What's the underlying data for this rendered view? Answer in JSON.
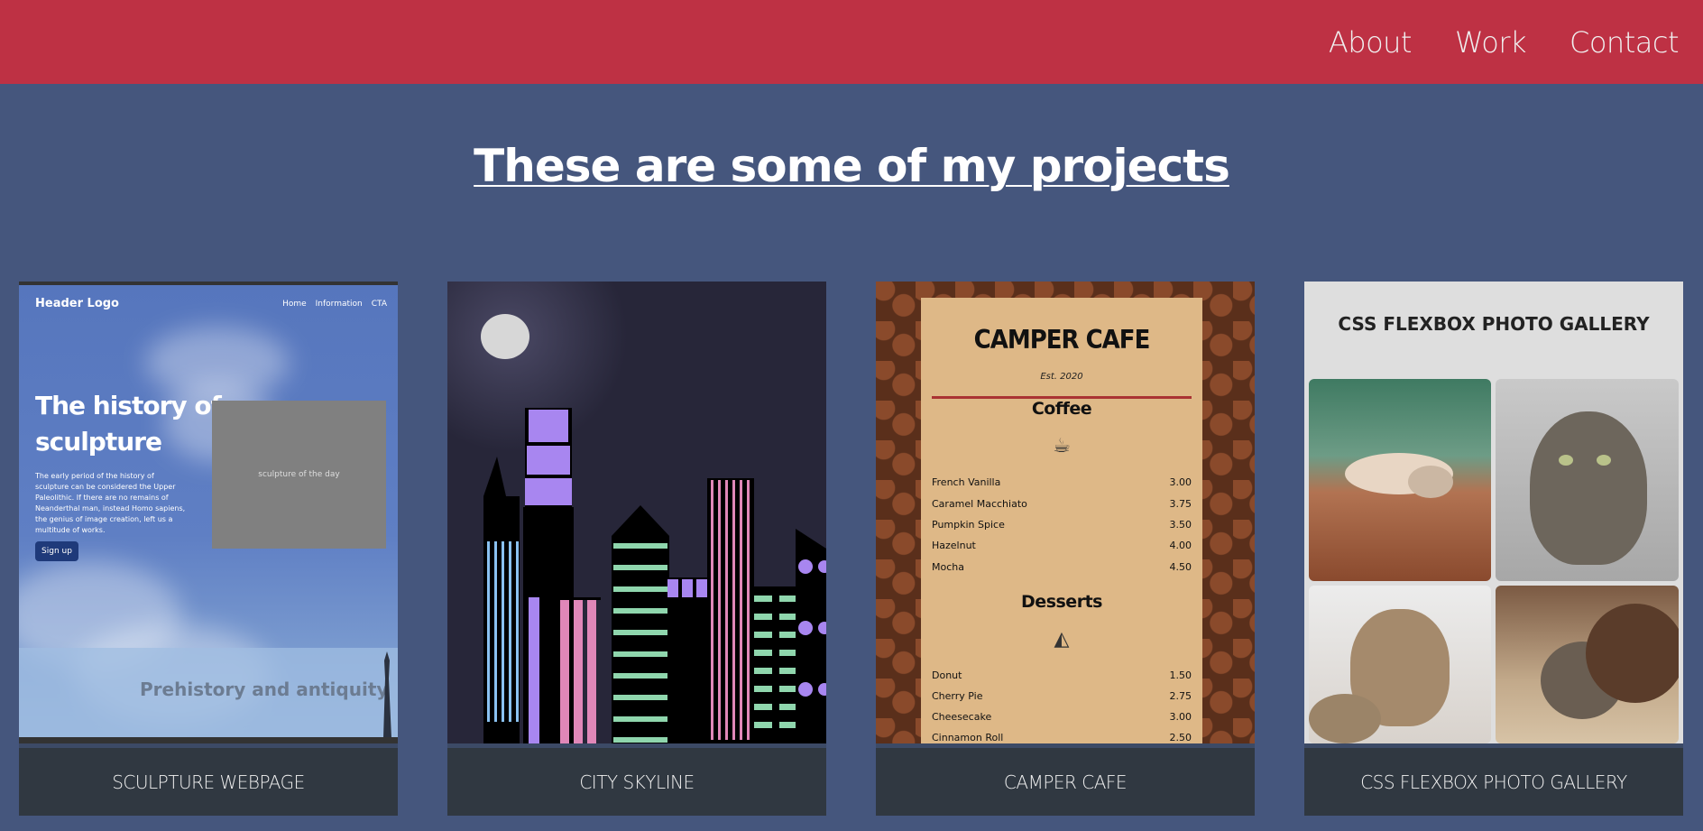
{
  "nav": {
    "links": [
      "About",
      "Work",
      "Contact"
    ]
  },
  "heading": "These are some of my projects",
  "projects": [
    {
      "caption": "SCULPTURE WEBPAGE",
      "thumb": {
        "logo": "Header Logo",
        "nav": [
          "Home",
          "Information",
          "CTA"
        ],
        "title_line1": "The history of",
        "title_line2": "sculpture",
        "paragraph": "The early period of the history of sculpture can be considered the Upper Paleolithic. If there are no remains of Neanderthal man, instead Homo sapiens, the genius of image creation, left us a multitude of works.",
        "button": "Sign up",
        "box": "sculpture of the day",
        "section": "Prehistory and antiquity"
      }
    },
    {
      "caption": "CITY SKYLINE"
    },
    {
      "caption": "CAMPER CAFE",
      "thumb": {
        "title": "CAMPER CAFE",
        "est": "Est. 2020",
        "coffee_heading": "Coffee",
        "coffee": [
          {
            "item": "French Vanilla",
            "price": "3.00"
          },
          {
            "item": "Caramel Macchiato",
            "price": "3.75"
          },
          {
            "item": "Pumpkin Spice",
            "price": "3.50"
          },
          {
            "item": "Hazelnut",
            "price": "4.00"
          },
          {
            "item": "Mocha",
            "price": "4.50"
          }
        ],
        "desserts_heading": "Desserts",
        "desserts": [
          {
            "item": "Donut",
            "price": "1.50"
          },
          {
            "item": "Cherry Pie",
            "price": "2.75"
          },
          {
            "item": "Cheesecake",
            "price": "3.00"
          },
          {
            "item": "Cinnamon Roll",
            "price": "2.50"
          }
        ]
      }
    },
    {
      "caption": "CSS FLEXBOX PHOTO GALLERY",
      "thumb": {
        "title": "CSS FLEXBOX PHOTO GALLERY"
      }
    }
  ],
  "colors": {
    "nav_bg": "#be3144",
    "page_bg": "#45567d",
    "caption_bg": "#303841"
  }
}
